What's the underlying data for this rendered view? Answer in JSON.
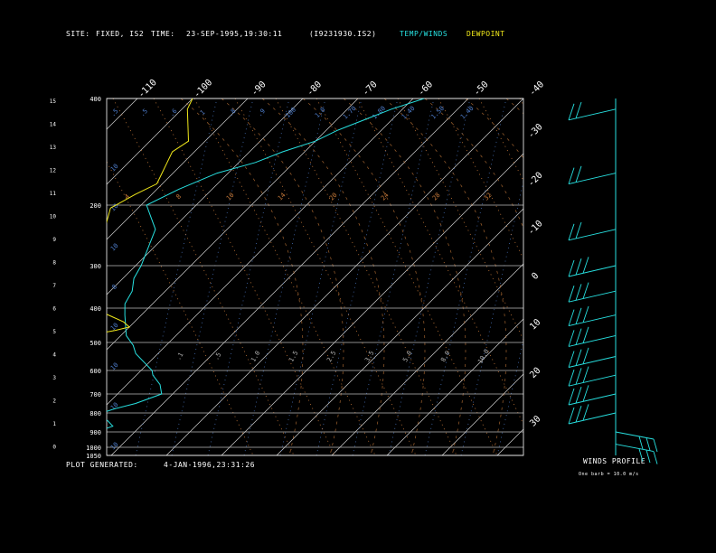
{
  "header": {
    "site_label": "SITE:",
    "site_value": "FIXED, IS2",
    "time_label": "TIME:",
    "time_value": "23-SEP-1995,19:30:11",
    "file_id": "(I9231930.IS2)",
    "legend_temp": "TEMP/WINDS",
    "legend_dew": "DEWPOINT"
  },
  "footer": {
    "plot_generated_label": "PLOT GENERATED:",
    "plot_generated_value": "4-JAN-1996,23:31:26",
    "winds_profile": "WINDS PROFILE",
    "barb_note": "One barb = 10.0 m/s"
  },
  "colors": {
    "temperature": "#27e0e0",
    "dewpoint": "#f0e81a",
    "frame": "#ffffff",
    "isotherm": "#cfcfcf",
    "mixing_ratio": "#4f7fcf",
    "dry_adiabat": "#c87a3a"
  },
  "chart_data": {
    "type": "line",
    "pressure_labels": [
      "400",
      "200",
      "300",
      "400",
      "500",
      "600",
      "700",
      "800",
      "900",
      "1000",
      "1050"
    ],
    "pressure_levels": [
      100,
      200,
      300,
      400,
      500,
      600,
      700,
      800,
      900,
      1000,
      1050
    ],
    "height_km_labels": [
      "15",
      "14",
      "13",
      "12",
      "11",
      "10",
      "9",
      "8",
      "7",
      "6",
      "5",
      "4",
      "3",
      "2",
      "1",
      "0"
    ],
    "top_temp_labels": [
      "-110",
      "-100",
      "-90",
      "-80",
      "-70",
      "-60",
      "-50",
      "-40"
    ],
    "right_temp_labels": [
      "-30",
      "-20",
      "-10",
      "0",
      "10",
      "20",
      "30"
    ],
    "mixing_ratio_top_labels": [
      ".5",
      ".5",
      ".6",
      "1",
      ".8",
      ".9",
      "100",
      "1.0",
      "1.70",
      "1.80",
      "1.40",
      "1.50",
      "1.40"
    ],
    "mixing_ratio_left_labels": [
      "10",
      "10",
      "10",
      "8",
      "10",
      "10",
      "10",
      "10"
    ],
    "adiabat_labels": [
      "4",
      "8",
      "10",
      "14",
      "20",
      "24",
      "28",
      "32"
    ],
    "lower_labels": [
      ".1",
      ".5",
      "1.0",
      "1.5",
      "2.5",
      "3.5",
      "5.0",
      "8.0",
      "10.0"
    ],
    "temperature_profile": [
      {
        "p": 1050,
        "t": -64
      },
      {
        "p": 1000,
        "t": -63
      },
      {
        "p": 960,
        "t": -55
      },
      {
        "p": 930,
        "t": -60
      },
      {
        "p": 900,
        "t": -57
      },
      {
        "p": 870,
        "t": -55
      },
      {
        "p": 840,
        "t": -57
      },
      {
        "p": 810,
        "t": -60
      },
      {
        "p": 780,
        "t": -58
      },
      {
        "p": 750,
        "t": -55
      },
      {
        "p": 700,
        "t": -52
      },
      {
        "p": 660,
        "t": -54
      },
      {
        "p": 620,
        "t": -57
      },
      {
        "p": 600,
        "t": -58
      },
      {
        "p": 570,
        "t": -61
      },
      {
        "p": 540,
        "t": -64
      },
      {
        "p": 510,
        "t": -66
      },
      {
        "p": 480,
        "t": -69
      },
      {
        "p": 450,
        "t": -71
      },
      {
        "p": 420,
        "t": -73
      },
      {
        "p": 390,
        "t": -75
      },
      {
        "p": 360,
        "t": -76
      },
      {
        "p": 330,
        "t": -78
      },
      {
        "p": 300,
        "t": -79
      },
      {
        "p": 270,
        "t": -81
      },
      {
        "p": 240,
        "t": -83
      },
      {
        "p": 220,
        "t": -86
      },
      {
        "p": 200,
        "t": -89
      },
      {
        "p": 185,
        "t": -86
      },
      {
        "p": 170,
        "t": -82
      },
      {
        "p": 160,
        "t": -77
      },
      {
        "p": 150,
        "t": -74
      },
      {
        "p": 140,
        "t": -70
      },
      {
        "p": 130,
        "t": -68
      },
      {
        "p": 120,
        "t": -65
      },
      {
        "p": 110,
        "t": -62
      },
      {
        "p": 100,
        "t": -58
      }
    ],
    "dewpoint_profile": [
      {
        "p": 1050,
        "t": -85
      },
      {
        "p": 1000,
        "t": -86
      },
      {
        "p": 960,
        "t": -86
      },
      {
        "p": 940,
        "t": -84
      },
      {
        "p": 920,
        "t": -83
      },
      {
        "p": 905,
        "t": -86
      },
      {
        "p": 898,
        "t": -100
      },
      {
        "p": 895,
        "t": -112
      },
      {
        "p": 890,
        "t": -117
      },
      {
        "p": 880,
        "t": -118
      },
      {
        "p": 860,
        "t": -117
      },
      {
        "p": 845,
        "t": -112
      },
      {
        "p": 840,
        "t": -106
      },
      {
        "p": 832,
        "t": -108
      },
      {
        "p": 824,
        "t": -114
      },
      {
        "p": 814,
        "t": -118
      },
      {
        "p": 790,
        "t": -114
      },
      {
        "p": 770,
        "t": -108
      },
      {
        "p": 740,
        "t": -104
      },
      {
        "p": 720,
        "t": -106
      },
      {
        "p": 700,
        "t": -108
      },
      {
        "p": 675,
        "t": -113
      },
      {
        "p": 650,
        "t": -108
      },
      {
        "p": 630,
        "t": -105
      },
      {
        "p": 610,
        "t": -102
      },
      {
        "p": 590,
        "t": -103
      },
      {
        "p": 575,
        "t": -98
      },
      {
        "p": 560,
        "t": -97
      },
      {
        "p": 545,
        "t": -94
      },
      {
        "p": 530,
        "t": -92
      },
      {
        "p": 520,
        "t": -87
      },
      {
        "p": 512,
        "t": -85
      },
      {
        "p": 500,
        "t": -83
      },
      {
        "p": 490,
        "t": -78
      },
      {
        "p": 480,
        "t": -76
      },
      {
        "p": 465,
        "t": -72
      },
      {
        "p": 455,
        "t": -70
      },
      {
        "p": 440,
        "t": -72
      },
      {
        "p": 425,
        "t": -75
      },
      {
        "p": 410,
        "t": -78
      },
      {
        "p": 395,
        "t": -82
      },
      {
        "p": 380,
        "t": -83
      },
      {
        "p": 360,
        "t": -85
      },
      {
        "p": 330,
        "t": -87
      },
      {
        "p": 300,
        "t": -89
      },
      {
        "p": 260,
        "t": -91
      },
      {
        "p": 230,
        "t": -93
      },
      {
        "p": 205,
        "t": -95
      },
      {
        "p": 190,
        "t": -93
      },
      {
        "p": 180,
        "t": -91
      },
      {
        "p": 170,
        "t": -92
      },
      {
        "p": 160,
        "t": -93
      },
      {
        "p": 150,
        "t": -94
      },
      {
        "p": 140,
        "t": -93
      },
      {
        "p": 130,
        "t": -95
      },
      {
        "p": 120,
        "t": -97
      },
      {
        "p": 110,
        "t": -99
      },
      {
        "p": 100,
        "t": -100
      }
    ],
    "wind_barbs_pressure": [
      110,
      170,
      240,
      300,
      360,
      420,
      480,
      550,
      620,
      700,
      800,
      900,
      980
    ]
  }
}
